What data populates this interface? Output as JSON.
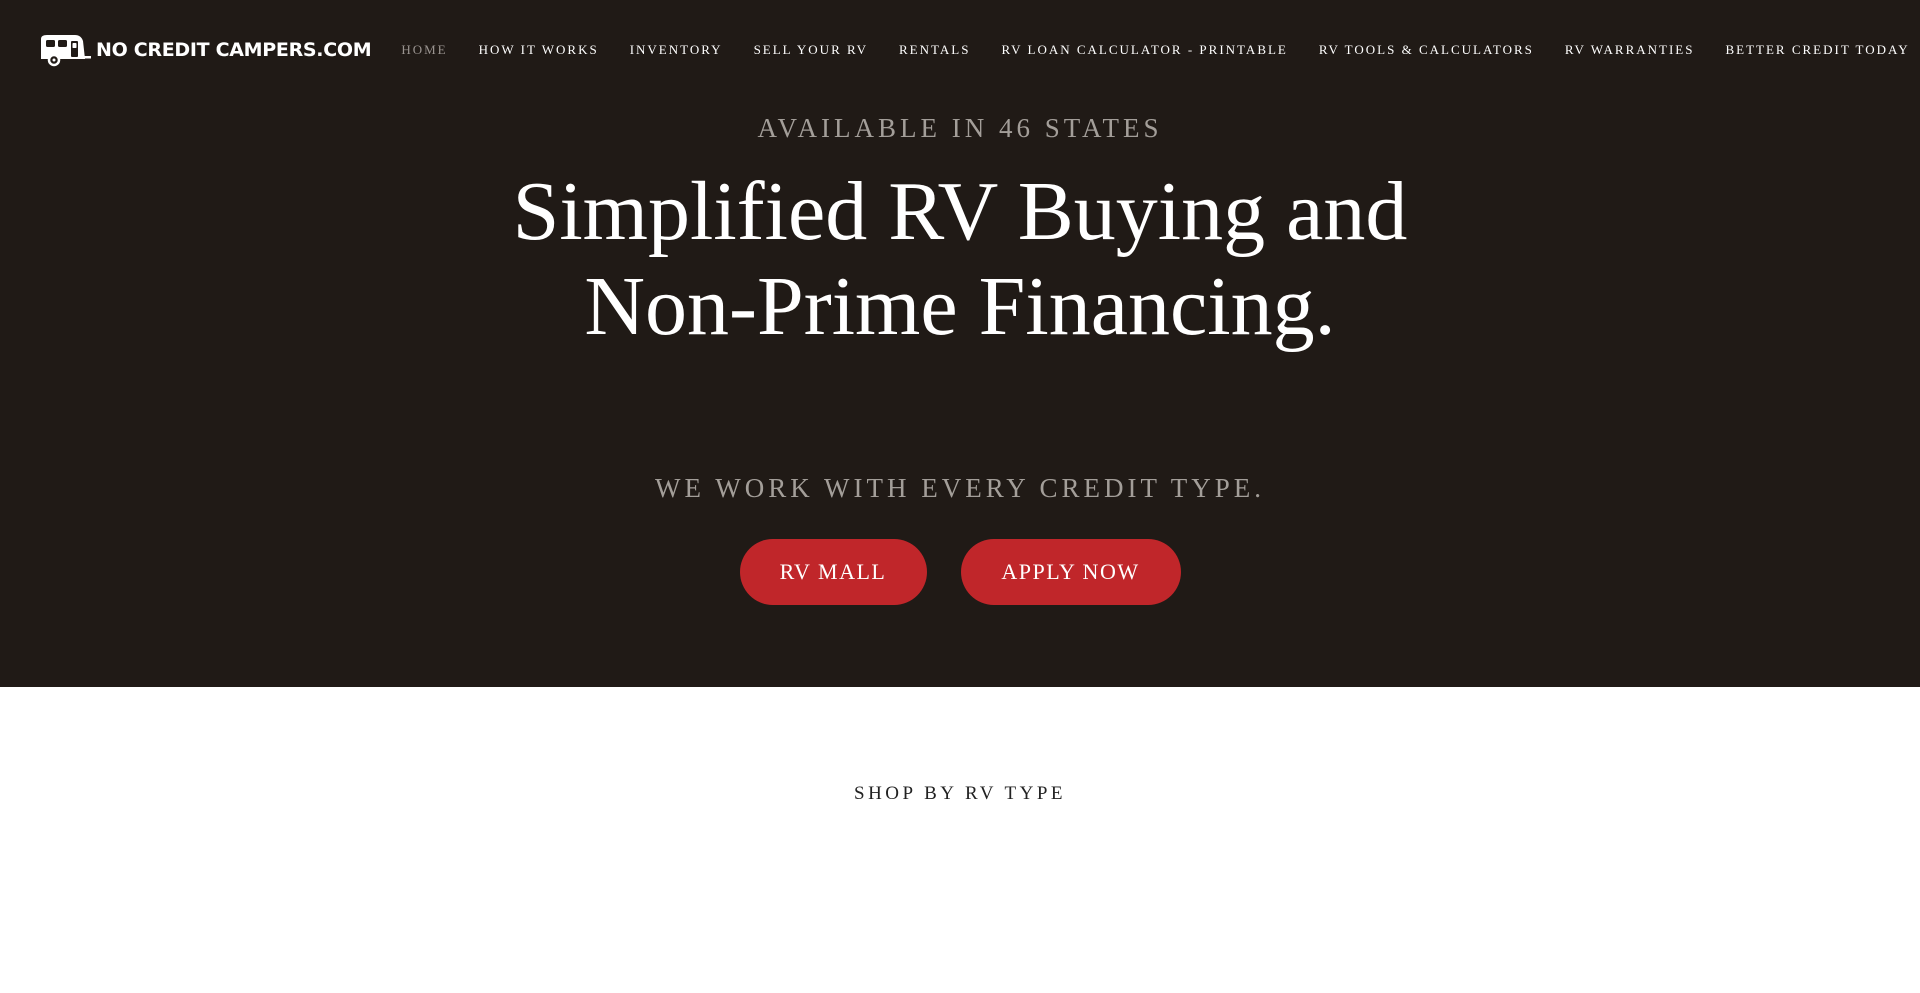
{
  "brand": {
    "name": "NO CREDIT CAMPERS.COM",
    "logo_icon": "camper-trailer-icon"
  },
  "nav": {
    "items": [
      {
        "label": "HOME",
        "active": true
      },
      {
        "label": "HOW IT WORKS",
        "active": false
      },
      {
        "label": "INVENTORY",
        "active": false
      },
      {
        "label": "SELL YOUR RV",
        "active": false
      },
      {
        "label": "RENTALS",
        "active": false
      },
      {
        "label": "RV LOAN CALCULATOR - PRINTABLE",
        "active": false
      },
      {
        "label": "RV TOOLS & CALCULATORS",
        "active": false
      },
      {
        "label": "RV WARRANTIES",
        "active": false
      },
      {
        "label": "BETTER CREDIT TODAY",
        "active": false
      }
    ]
  },
  "hero": {
    "eyebrow": "AVAILABLE IN 46 STATES",
    "headline": "Simplified RV Buying and Non-Prime Financing.",
    "subhead": "WE WORK WITH EVERY CREDIT TYPE.",
    "buttons": {
      "rv_mall": "RV MALL",
      "apply_now": "APPLY NOW"
    }
  },
  "shop": {
    "title": "SHOP BY RV TYPE"
  },
  "colors": {
    "hero_bg": "#201a16",
    "accent_red": "#c0262a",
    "muted_text": "#a39e99",
    "white": "#ffffff"
  }
}
